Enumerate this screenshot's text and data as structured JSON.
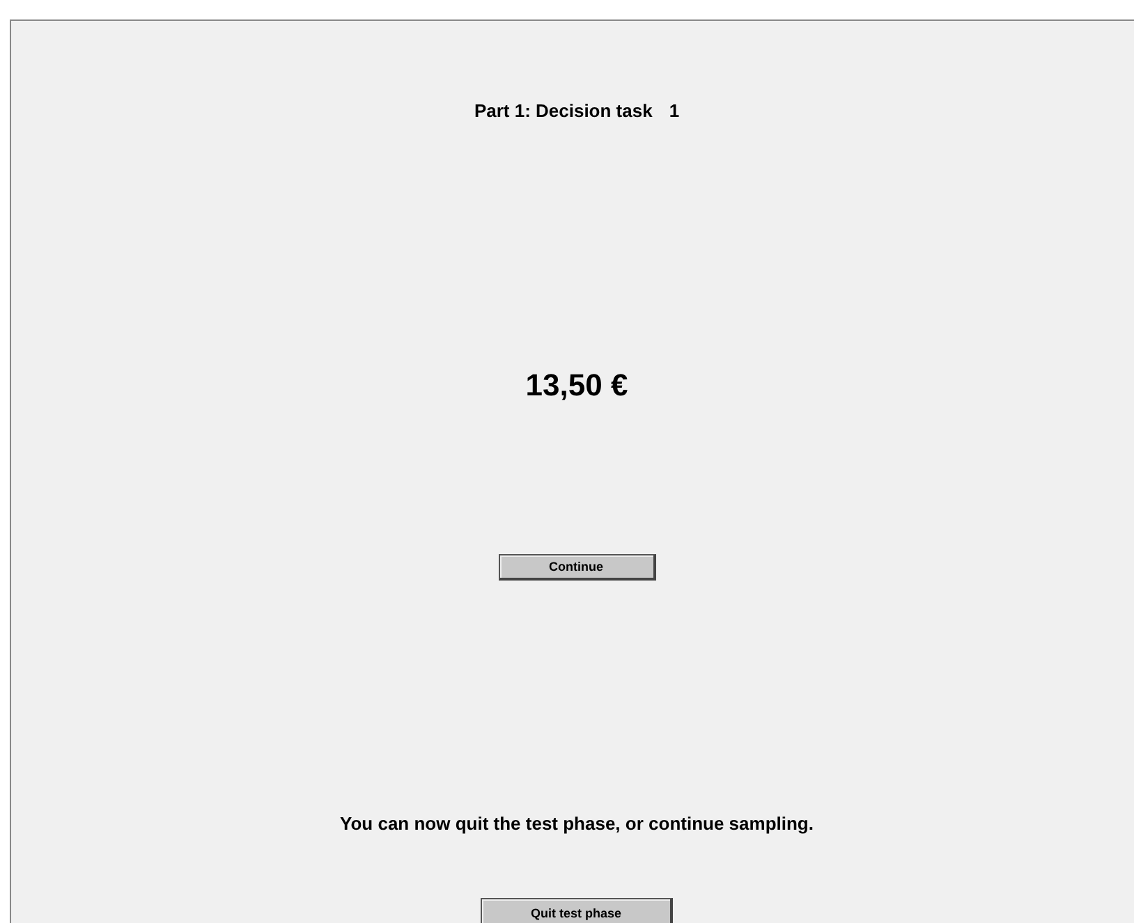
{
  "header": {
    "title": "Part 1: Decision task",
    "task_number": "1"
  },
  "amount": "13,50 €",
  "continue_button": "Continue",
  "message": "You can now quit the test phase, or continue sampling.",
  "quit_button": "Quit test phase"
}
